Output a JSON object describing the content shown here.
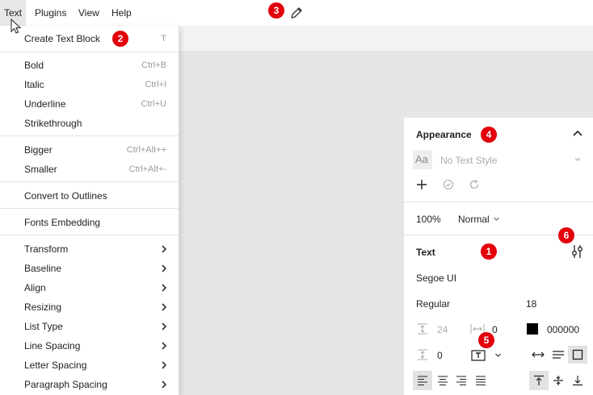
{
  "menubar": {
    "items": [
      {
        "label": "Text",
        "active": true
      },
      {
        "label": "Plugins",
        "active": false
      },
      {
        "label": "View",
        "active": false
      },
      {
        "label": "Help",
        "active": false
      }
    ]
  },
  "text_menu": {
    "items": [
      {
        "label": "Create Text Block",
        "shortcut": "T"
      },
      {
        "label": "Bold",
        "shortcut": "Ctrl+B"
      },
      {
        "label": "Italic",
        "shortcut": "Ctrl+I"
      },
      {
        "label": "Underline",
        "shortcut": "Ctrl+U"
      },
      {
        "label": "Strikethrough",
        "shortcut": ""
      },
      {
        "label": "Bigger",
        "shortcut": "Ctrl+Alt++"
      },
      {
        "label": "Smaller",
        "shortcut": "Ctrl+Alt+-"
      },
      {
        "label": "Convert to Outlines",
        "shortcut": ""
      },
      {
        "label": "Fonts Embedding",
        "shortcut": ""
      },
      {
        "label": "Transform",
        "submenu": true
      },
      {
        "label": "Baseline",
        "submenu": true
      },
      {
        "label": "Align",
        "submenu": true
      },
      {
        "label": "Resizing",
        "submenu": true
      },
      {
        "label": "List Type",
        "submenu": true
      },
      {
        "label": "Line Spacing",
        "submenu": true
      },
      {
        "label": "Letter Spacing",
        "submenu": true
      },
      {
        "label": "Paragraph Spacing",
        "submenu": true
      }
    ]
  },
  "appearance": {
    "title": "Appearance",
    "text_style_icon_label": "Aa",
    "text_style": "No Text Style",
    "opacity": "100%",
    "blend_mode": "Normal"
  },
  "text_panel": {
    "title": "Text",
    "font_family": "Segoe UI",
    "font_weight": "Regular",
    "font_size": "18",
    "line_height": "24",
    "letter_spacing": "0",
    "color_hex": "000000",
    "color_value": "#000000",
    "paragraph_spacing": "0"
  },
  "badges": [
    "1",
    "2",
    "3",
    "4",
    "5",
    "6"
  ],
  "colors": {
    "badge": "#e3000b",
    "menu_bg": "#ffffff",
    "canvas_bg": "#e6e6e6",
    "selected_button": "#e2e2e2"
  }
}
